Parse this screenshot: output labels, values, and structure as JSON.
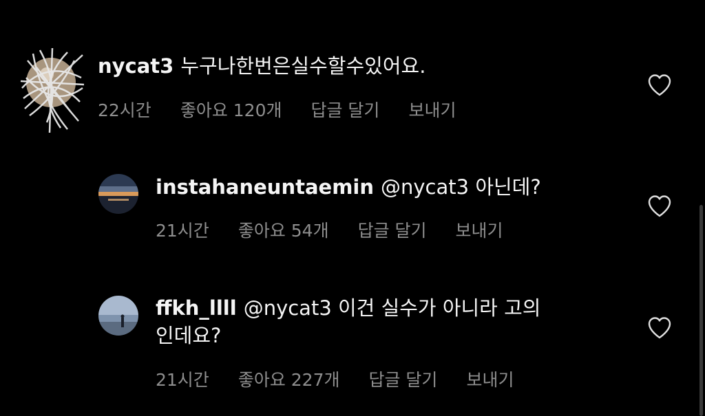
{
  "comments": [
    {
      "username": "nycat3",
      "text": "누구나한번은실수할수있어요.",
      "time": "22시간",
      "likes": "좋아요 120개",
      "reply": "답글 달기",
      "send": "보내기",
      "avatar_icon": "scribbled-avatar",
      "heart_icon": "heart-outline-icon"
    },
    {
      "username": "instahaneuntaemin",
      "text": "@nycat3 아닌데?",
      "time": "21시간",
      "likes": "좋아요 54개",
      "reply": "답글 달기",
      "send": "보내기",
      "avatar_icon": "sunset-sea-avatar",
      "heart_icon": "heart-outline-icon"
    },
    {
      "username": "ffkh_llll",
      "text_line1": "@nycat3 이건 실수가 아니라 고의",
      "text_line2": "인데요?",
      "time": "21시간",
      "likes": "좋아요 227개",
      "reply": "답글 달기",
      "send": "보내기",
      "avatar_icon": "beach-person-avatar",
      "heart_icon": "heart-outline-icon"
    }
  ],
  "colors": {
    "background": "#000000",
    "text": "#f5f5f5",
    "meta": "#8e8e8e",
    "heart": "#e0e0e0"
  }
}
